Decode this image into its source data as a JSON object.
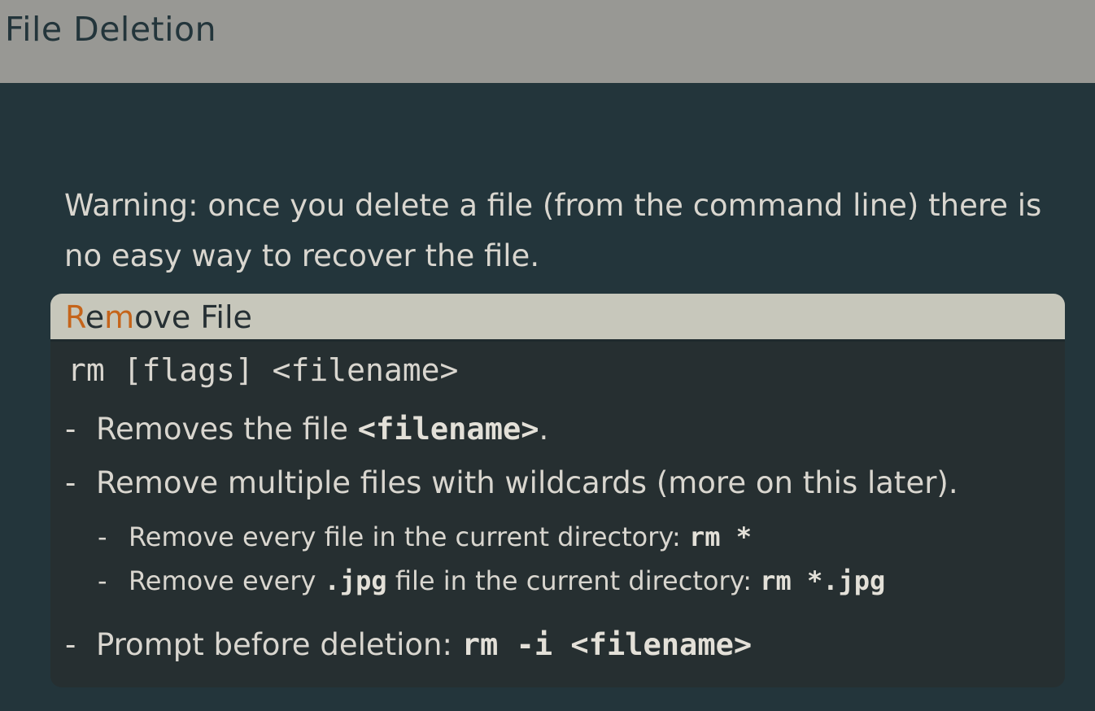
{
  "header": {
    "title": "File Deletion"
  },
  "warning": {
    "text": "Warning: once you delete a file (from the command line) there is no easy way to recover the file."
  },
  "block": {
    "title_parts": [
      "R",
      "e",
      "m",
      "ove File"
    ],
    "syntax": "rm [flags] <filename>",
    "bullets": [
      {
        "prefix": "Removes the file ",
        "code": "<filename>",
        "suffix": "."
      },
      {
        "text": "Remove multiple files with wildcards (more on this later)."
      },
      {
        "prefix": "Remove every file in the current directory: ",
        "code": "rm *"
      },
      {
        "prefix": "Remove every ",
        "code_mid": ".jpg",
        "middle": " file in the current directory: ",
        "code": "rm *.jpg"
      },
      {
        "prefix": "Prompt before deletion: ",
        "code": "rm -i <filename>"
      }
    ],
    "dash": "-"
  },
  "colors": {
    "background": "#23353b",
    "titlebar": "#989894",
    "block_header": "#c7c7bb",
    "block_body": "#262f31",
    "accent": "#c5641a",
    "text": "#d9d6cf"
  }
}
